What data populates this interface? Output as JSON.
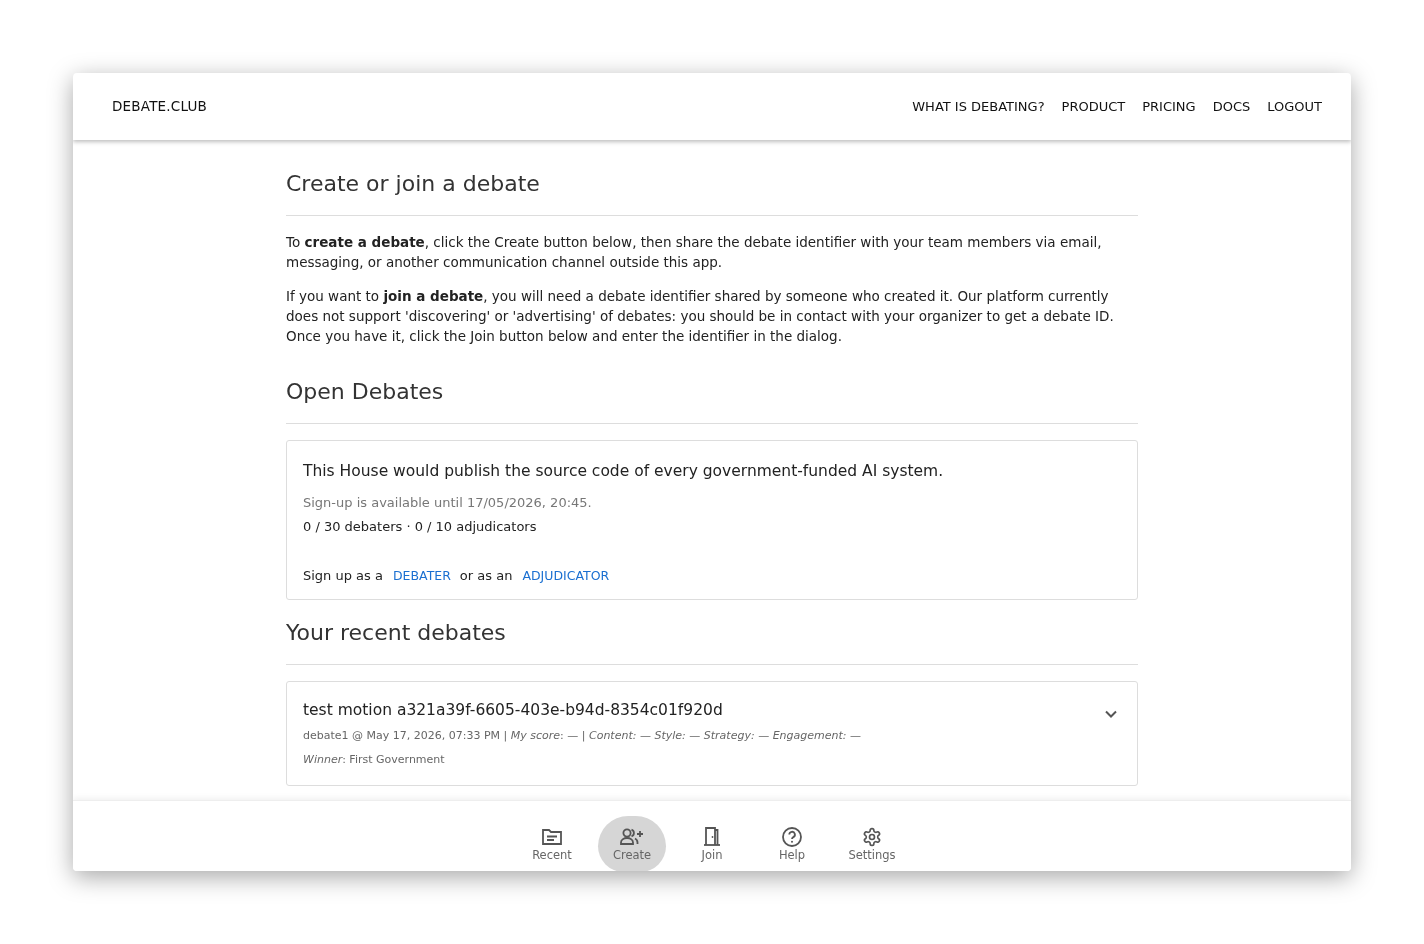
{
  "header": {
    "brand": "DEBATE.CLUB",
    "nav": [
      "WHAT IS DEBATING?",
      "PRODUCT",
      "PRICING",
      "DOCS",
      "LOGOUT"
    ]
  },
  "intro": {
    "title": "Create or join a debate",
    "paragraphs": [
      "To **create a debate**, click the Create button below, then share the debate identifier with your team members via email, messaging, or another communication channel outside this app.",
      "If you want to **join a debate**, you will need a debate identifier shared by someone who created it. Our platform currently does not support 'discovering' or 'advertising' of debates: you should be in contact with your organizer to get a debate ID. Once you have it, click the Join button below and enter the identifier in the dialog."
    ]
  },
  "open_debates": {
    "title": "Open Debates",
    "debates": [
      {
        "motion": "This House would publish the source code of every government-funded AI system.",
        "signup_note": "Sign-up is available until 17/05/2026, 20:45.",
        "counts": "0 / 30 debaters · 0 / 10 adjudicators",
        "signup_prefix": "Sign up as a",
        "debater_button": "DEBATER",
        "signup_joiner": "or as an",
        "adjudicator_button": "ADJUDICATOR"
      }
    ]
  },
  "recent_debates": {
    "title": "Your recent debates",
    "debates": [
      {
        "motion": "test motion a321a39f-6605-403e-b94d-8354c01f920d",
        "meta": "debate1 @ May 17, 2026, 07:33 PM | *My score*: — | *Content:* — *Style:* — *Strategy:* — *Engagement:* —",
        "winner": "*Winner*: First Government",
        "expanded": false
      }
    ]
  },
  "bottom_nav": [
    {
      "label": "Recent",
      "selected": false
    },
    {
      "label": "Create",
      "selected": true
    },
    {
      "label": "Join",
      "selected": false
    },
    {
      "label": "Help",
      "selected": false
    },
    {
      "label": "Settings",
      "selected": false
    }
  ]
}
